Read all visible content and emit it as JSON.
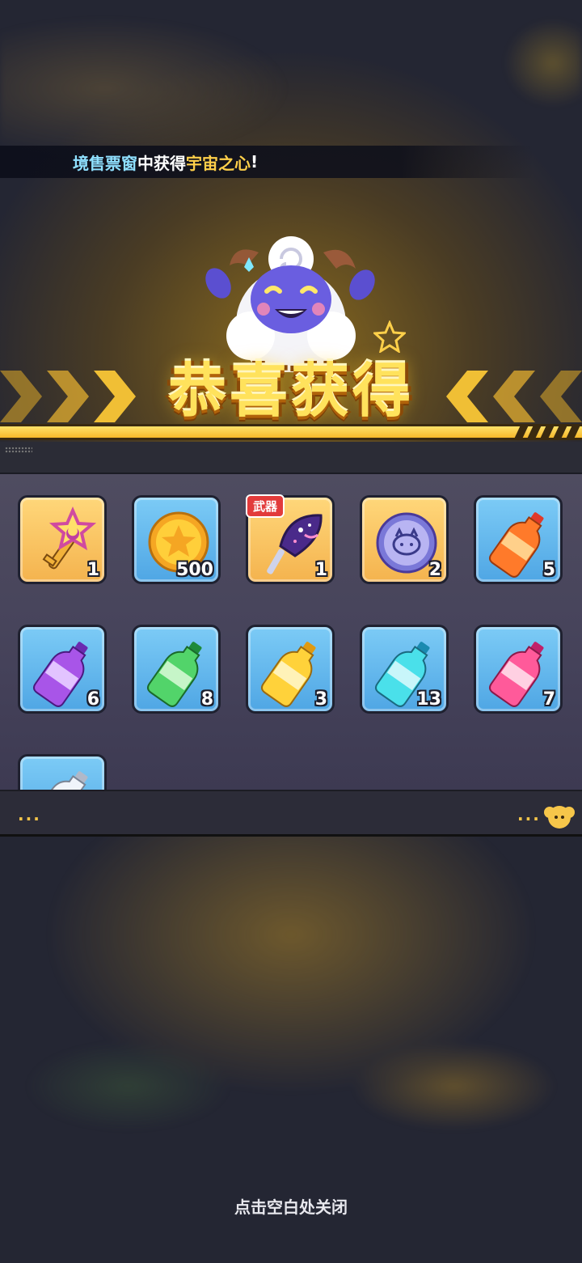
{
  "ticker": {
    "part1": "境售票窗",
    "part2": "中获得",
    "part3": "宇宙之心",
    "part4": "!"
  },
  "title": "恭喜获得",
  "items": [
    {
      "icon": "star-key-icon",
      "qty": "1",
      "style": "gold"
    },
    {
      "icon": "gold-coin-icon",
      "qty": "500",
      "style": "blue"
    },
    {
      "icon": "weapon-fan-icon",
      "qty": "1",
      "style": "gold",
      "tag": "武器"
    },
    {
      "icon": "cat-medal-icon",
      "qty": "2",
      "style": "gold"
    },
    {
      "icon": "orange-bottle-icon",
      "qty": "5",
      "style": "blue"
    },
    {
      "icon": "purple-bottle-icon",
      "qty": "6",
      "style": "blue"
    },
    {
      "icon": "green-bottle-icon",
      "qty": "8",
      "style": "blue"
    },
    {
      "icon": "yellow-bottle-icon",
      "qty": "3",
      "style": "blue"
    },
    {
      "icon": "cyan-bottle-icon",
      "qty": "13",
      "style": "blue"
    },
    {
      "icon": "pink-bottle-icon",
      "qty": "7",
      "style": "blue"
    },
    {
      "icon": "white-bottle-icon",
      "qty": "",
      "style": "blue"
    }
  ],
  "footer": {
    "dots_left": "...",
    "dots_right": "..."
  },
  "close_hint": "点击空白处关闭",
  "colors": {
    "gold": "#ffd04a",
    "blue": "#8fe0ff",
    "tag_red": "#e23b3b"
  }
}
